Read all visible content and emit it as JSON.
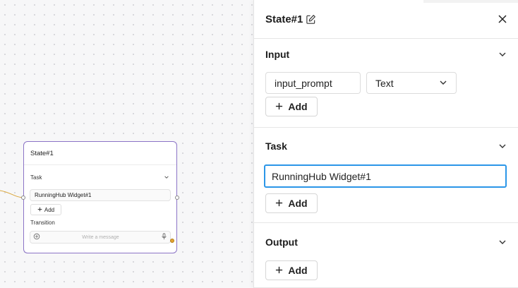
{
  "canvas": {
    "node": {
      "title": "State#1",
      "task_label": "Task",
      "widget_name": "RunningHub Widget#1",
      "add_label": "Add",
      "transition_label": "Transition",
      "message_placeholder": "Write a message"
    }
  },
  "panel": {
    "title": "State#1",
    "input": {
      "title": "Input",
      "field_name": "input_prompt",
      "field_type": "Text",
      "add_label": "Add"
    },
    "task": {
      "title": "Task",
      "value": "RunningHub Widget#1",
      "add_label": "Add"
    },
    "output": {
      "title": "Output",
      "add_label": "Add"
    }
  },
  "colors": {
    "node_border": "#8b73c6",
    "focus_border": "#2b96e8",
    "port_active": "#e3a431",
    "edge": "#d9a53a"
  },
  "icons": [
    "edit-icon",
    "close-icon",
    "chevron-down-icon",
    "plus-icon",
    "add-circle-icon",
    "microphone-icon"
  ]
}
